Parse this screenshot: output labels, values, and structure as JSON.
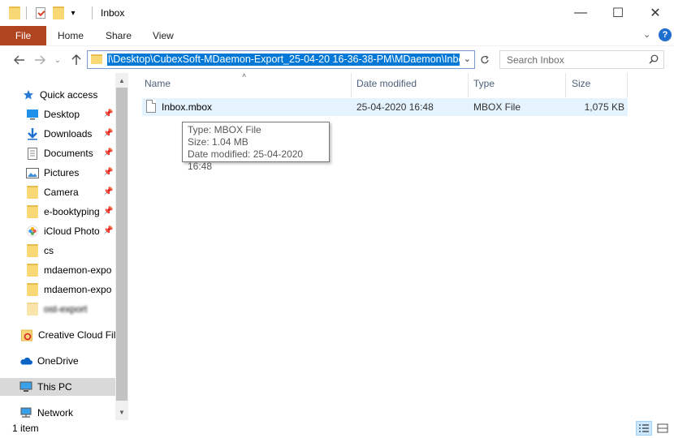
{
  "window": {
    "title": "Inbox",
    "controls": {
      "minimize": "—",
      "maximize": "☐",
      "close": "✕"
    }
  },
  "ribbon": {
    "tabs": [
      "File",
      "Home",
      "Share",
      "View"
    ]
  },
  "address_bar": {
    "path": "...\\l\\Desktop\\CubexSoft-MDaemon-Export_25-04-20 16-36-38-PM\\MDaemon\\Inbox",
    "visible_path": "l\\Desktop\\CubexSoft-MDaemon-Export_25-04-20 16-36-38-PM\\MDaemon\\Inbox"
  },
  "search": {
    "placeholder": "Search Inbox"
  },
  "nav_pane": {
    "items": [
      {
        "label": "Quick access",
        "icon": "star-icon",
        "pinned": false
      },
      {
        "label": "Desktop",
        "icon": "desktop-icon",
        "pinned": true
      },
      {
        "label": "Downloads",
        "icon": "download-icon",
        "pinned": true
      },
      {
        "label": "Documents",
        "icon": "documents-icon",
        "pinned": true
      },
      {
        "label": "Pictures",
        "icon": "pictures-icon",
        "pinned": true
      },
      {
        "label": "Camera",
        "icon": "folder-icon",
        "pinned": true
      },
      {
        "label": "e-booktyping",
        "icon": "folder-icon",
        "pinned": true
      },
      {
        "label": "iCloud Photo",
        "icon": "icloud-photos-icon",
        "pinned": true
      },
      {
        "label": "cs",
        "icon": "folder-icon",
        "pinned": false
      },
      {
        "label": "mdaemon-expo",
        "icon": "folder-icon",
        "pinned": false
      },
      {
        "label": "mdaemon-expo",
        "icon": "folder-icon",
        "pinned": false
      },
      {
        "label": "ost-export",
        "icon": "folder-icon",
        "pinned": false,
        "blurred": true
      },
      {
        "label": "Creative Cloud Fil",
        "icon": "creative-cloud-icon",
        "pinned": false
      },
      {
        "label": "OneDrive",
        "icon": "onedrive-icon",
        "pinned": false
      },
      {
        "label": "This PC",
        "icon": "this-pc-icon",
        "pinned": false,
        "selected": true
      },
      {
        "label": "Network",
        "icon": "network-icon",
        "pinned": false
      }
    ]
  },
  "columns": [
    "Name",
    "Date modified",
    "Type",
    "Size"
  ],
  "files": [
    {
      "name": "Inbox.mbox",
      "date_modified": "25-04-2020 16:48",
      "type": "MBOX File",
      "size": "1,075 KB"
    }
  ],
  "tooltip": {
    "type_line": "Type: MBOX File",
    "size_line": "Size: 1.04 MB",
    "date_line": "Date modified: 25-04-2020 16:48"
  },
  "status": {
    "item_count": "1 item"
  }
}
